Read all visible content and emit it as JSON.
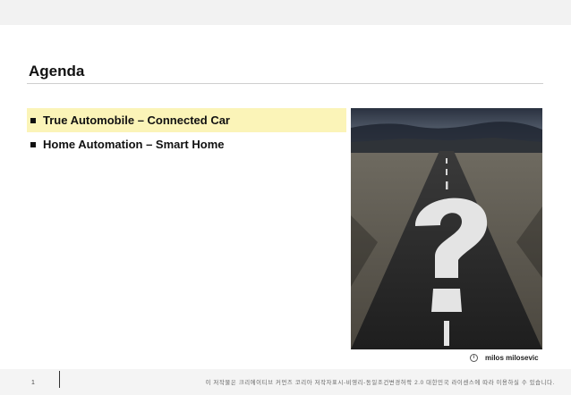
{
  "slide": {
    "title": "Agenda",
    "items": [
      {
        "label": "True Automobile – Connected Car"
      },
      {
        "label": "Home Automation – Smart Home"
      }
    ]
  },
  "photo": {
    "credit": "milos milosevic",
    "license_icon": "cc-info-icon"
  },
  "footer": {
    "page_number": "1",
    "license_text": "이 저작물은 크리에이티브 커먼즈 코리아 저작자표시-비영리-동일조건변경허락 2.0 대한민국 라이센스에 따라 이용하실 수 있습니다."
  },
  "colors": {
    "highlight": "#fbf4b8",
    "title": "#111111"
  }
}
